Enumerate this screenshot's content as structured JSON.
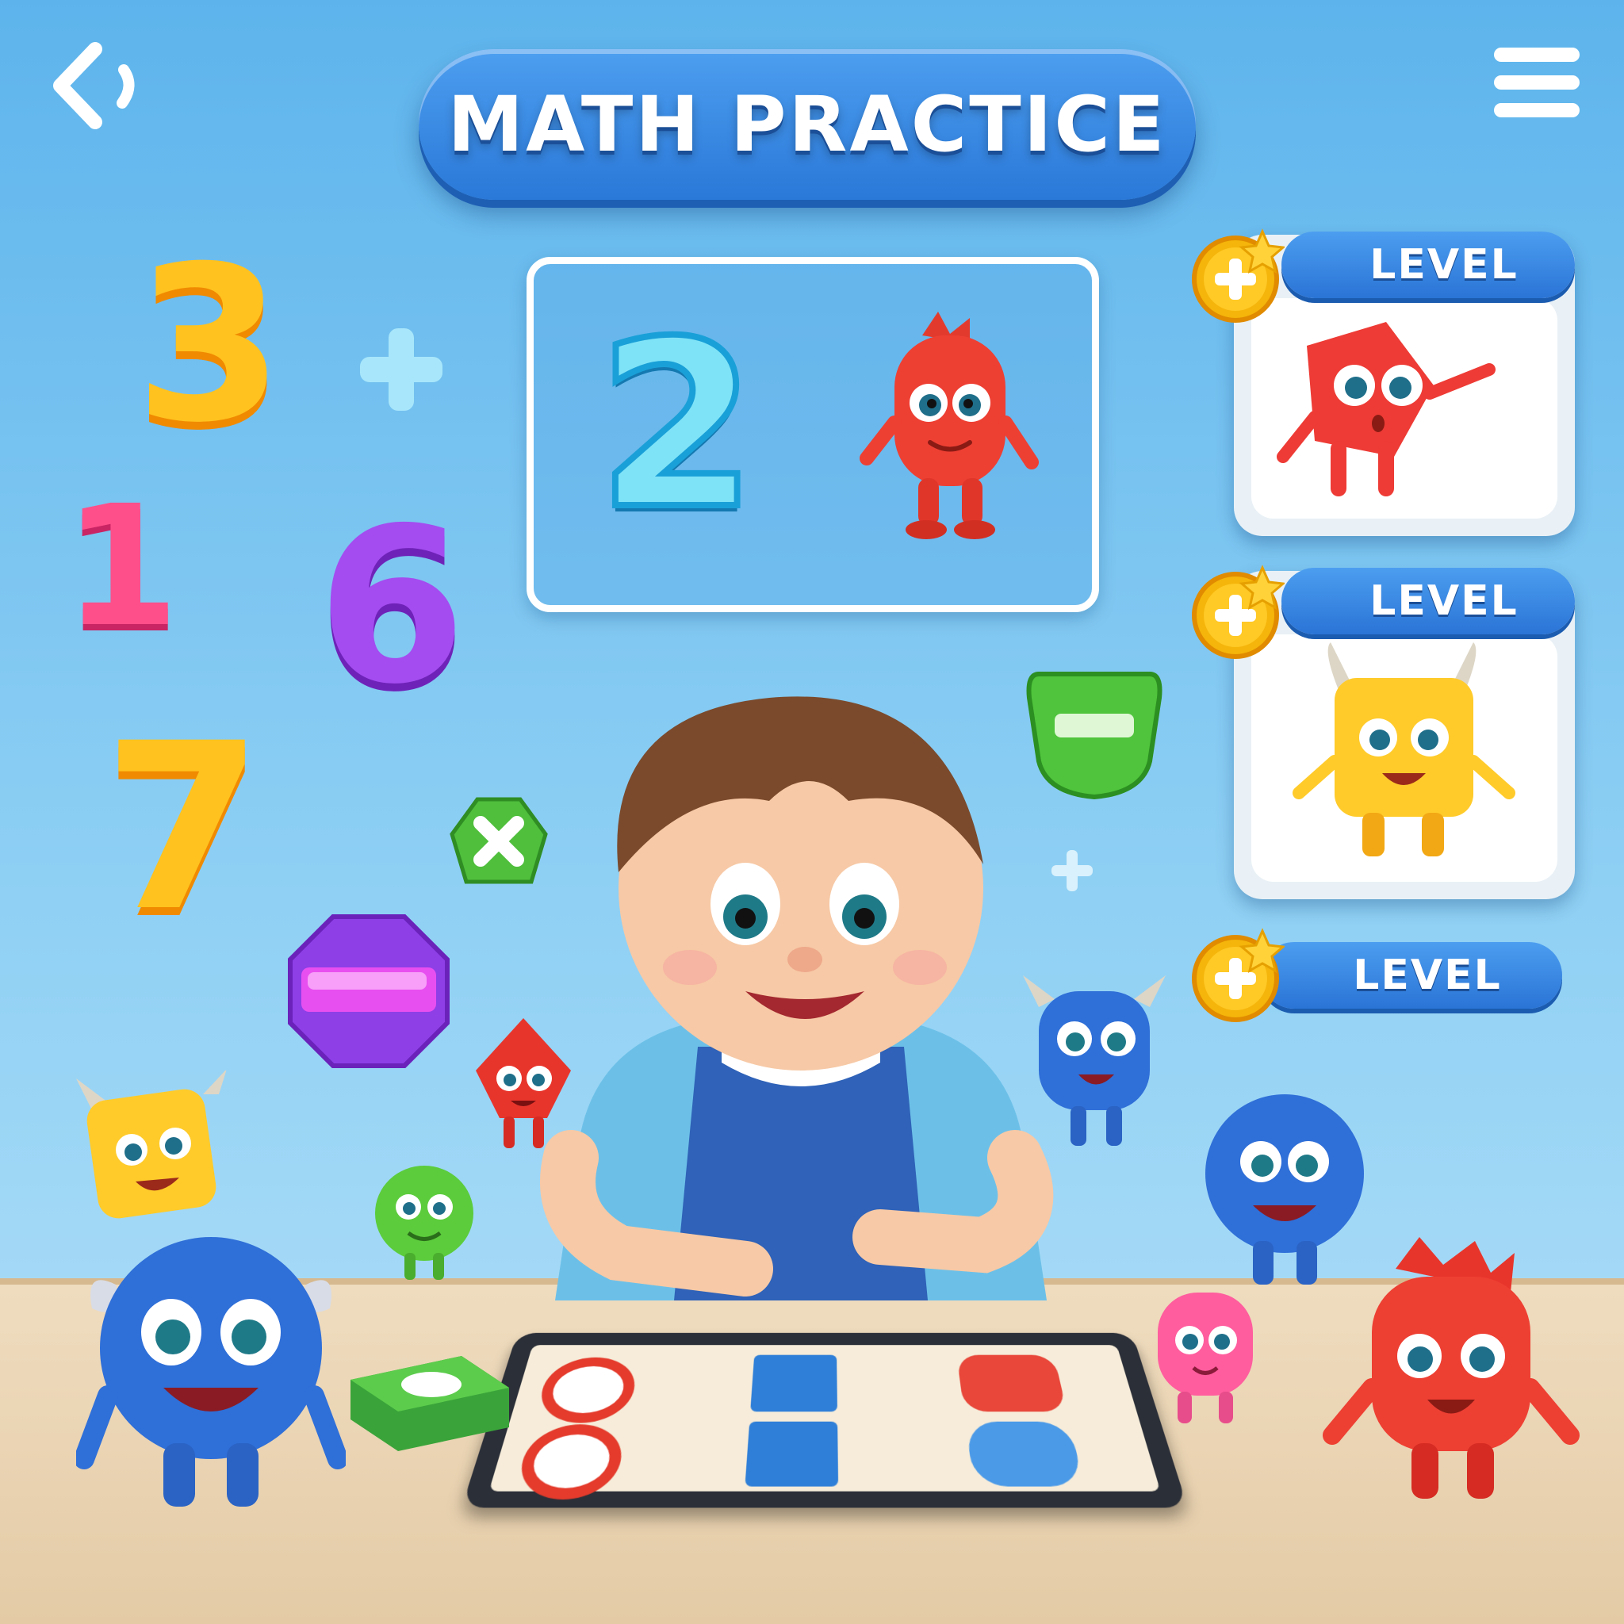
{
  "header": {
    "title": "MATH PRACTICE"
  },
  "icons": {
    "back": "back-arrow-icon",
    "menu": "hamburger-menu-icon",
    "coin": "plus-star-coin-icon"
  },
  "featured": {
    "number": "2",
    "character": "red-monster"
  },
  "levels": [
    {
      "label": "LEVEL",
      "character": "red-shape-monster"
    },
    {
      "label": "LEVEL",
      "character": "yellow-horned-monster"
    },
    {
      "label": "LEVEL"
    }
  ],
  "floating_numbers": [
    "3",
    "1",
    "6",
    "7"
  ],
  "colors": {
    "accent_blue": "#2a78d8",
    "background": "#5db4ec",
    "coin_gold": "#f5b50a"
  }
}
